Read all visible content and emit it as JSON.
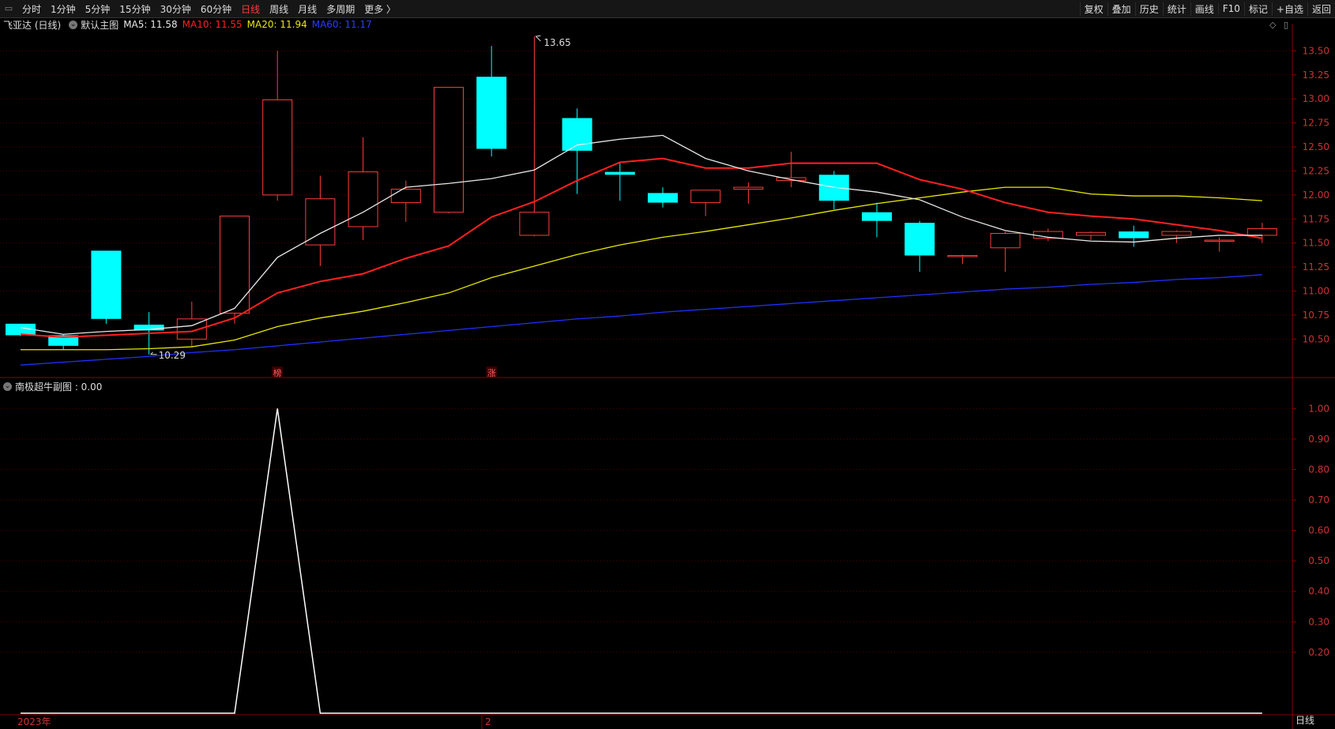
{
  "toolbar": {
    "periods": [
      "分时",
      "1分钟",
      "5分钟",
      "15分钟",
      "30分钟",
      "60分钟",
      "日线",
      "周线",
      "月线",
      "多周期",
      "更多 〉"
    ],
    "active_period": "日线",
    "tools": [
      "复权",
      "叠加",
      "历史",
      "统计",
      "画线",
      "F10",
      "标记",
      "+自选",
      "返回"
    ]
  },
  "main_header": {
    "stock": "飞亚达 (日线)",
    "indicator": "默认主图",
    "ma5_label": "MA5: 11.58",
    "ma10_label": "MA10: 11.55",
    "ma20_label": "MA20: 11.94",
    "ma60_label": "MA60: 11.17"
  },
  "sub_header": {
    "name": "南极超牛副图 : 0.00"
  },
  "bottom": {
    "year_label": "2023年",
    "month_label": "2",
    "period_label": "日线"
  },
  "colors": {
    "up": "#ff3b3b",
    "down": "#00ffff",
    "ma5": "#e8e8e8",
    "ma10": "#ff2020",
    "ma20": "#e8e800",
    "ma60": "#2030ff",
    "axis": "#8b0000",
    "sub_line": "#ffffff"
  },
  "chart_data": [
    {
      "type": "candlestick",
      "x": [
        1,
        2,
        3,
        4,
        5,
        6,
        7,
        8,
        9,
        10,
        11,
        12,
        13,
        14,
        15,
        16,
        17,
        18,
        19,
        20,
        21,
        22,
        23,
        24,
        25,
        26,
        27,
        28,
        29,
        30
      ],
      "open": [
        10.66,
        10.54,
        11.42,
        10.65,
        10.5,
        10.77,
        12.0,
        11.48,
        11.67,
        11.92,
        11.82,
        13.23,
        11.58,
        12.8,
        12.24,
        12.02,
        11.92,
        12.06,
        12.15,
        12.21,
        11.82,
        11.71,
        11.37,
        11.45,
        11.55,
        11.58,
        11.62,
        11.58,
        11.53,
        11.58
      ],
      "high": [
        10.66,
        10.55,
        11.42,
        10.78,
        10.89,
        11.78,
        13.5,
        12.2,
        12.6,
        12.15,
        11.88,
        13.55,
        13.65,
        12.9,
        12.34,
        12.08,
        12.05,
        12.13,
        12.45,
        12.25,
        11.92,
        11.73,
        11.38,
        11.62,
        11.65,
        11.62,
        11.68,
        11.63,
        11.56,
        11.71
      ],
      "low": [
        10.53,
        10.39,
        10.66,
        10.34,
        10.42,
        10.66,
        11.94,
        11.26,
        11.53,
        11.72,
        11.81,
        12.4,
        11.57,
        12.01,
        11.94,
        11.87,
        11.78,
        11.91,
        12.08,
        11.85,
        11.56,
        11.2,
        11.28,
        11.2,
        11.52,
        11.53,
        11.46,
        11.5,
        11.41,
        11.5
      ],
      "close": [
        10.54,
        10.43,
        10.71,
        10.59,
        10.71,
        11.78,
        12.99,
        11.96,
        12.24,
        12.06,
        13.12,
        12.48,
        11.82,
        12.46,
        12.21,
        11.92,
        12.05,
        12.08,
        12.18,
        11.94,
        11.73,
        11.37,
        11.37,
        11.6,
        11.62,
        11.61,
        11.55,
        11.62,
        11.53,
        11.65
      ],
      "ma5": [
        10.62,
        10.55,
        10.58,
        10.6,
        10.64,
        10.82,
        11.35,
        11.6,
        11.82,
        12.08,
        12.12,
        12.17,
        12.26,
        12.52,
        12.58,
        12.62,
        12.38,
        12.25,
        12.16,
        12.08,
        12.03,
        11.95,
        11.77,
        11.63,
        11.56,
        11.52,
        11.51,
        11.55,
        11.58,
        11.58
      ],
      "ma10": [
        10.55,
        10.52,
        10.54,
        10.56,
        10.58,
        10.72,
        10.98,
        11.1,
        11.18,
        11.34,
        11.47,
        11.77,
        11.93,
        12.15,
        12.34,
        12.38,
        12.28,
        12.28,
        12.33,
        12.33,
        12.33,
        12.16,
        12.06,
        11.92,
        11.82,
        11.78,
        11.75,
        11.69,
        11.63,
        11.55
      ],
      "ma20": [
        10.39,
        10.39,
        10.39,
        10.4,
        10.42,
        10.49,
        10.63,
        10.72,
        10.79,
        10.88,
        10.98,
        11.14,
        11.26,
        11.38,
        11.48,
        11.56,
        11.62,
        11.69,
        11.76,
        11.84,
        11.91,
        11.97,
        12.03,
        12.08,
        12.08,
        12.01,
        11.99,
        11.99,
        11.97,
        11.94
      ],
      "ma60": [
        10.23,
        10.26,
        10.29,
        10.32,
        10.36,
        10.39,
        10.43,
        10.47,
        10.51,
        10.55,
        10.59,
        10.63,
        10.67,
        10.71,
        10.74,
        10.78,
        10.81,
        10.84,
        10.87,
        10.9,
        10.93,
        10.96,
        10.99,
        11.02,
        11.04,
        11.07,
        11.09,
        11.12,
        11.14,
        11.17
      ],
      "max_label": "13.65",
      "min_label": "10.29",
      "markers": [
        "榜",
        "涨"
      ],
      "ylim": [
        10.1,
        13.7
      ],
      "yticks": [
        "13.50",
        "13.25",
        "13.00",
        "12.75",
        "12.50",
        "12.25",
        "12.00",
        "11.75",
        "11.50",
        "11.25",
        "11.00",
        "10.75",
        "10.50"
      ]
    },
    {
      "type": "line",
      "x": [
        1,
        2,
        3,
        4,
        5,
        6,
        7,
        8,
        9,
        10,
        11,
        12,
        13,
        14,
        15,
        16,
        17,
        18,
        19,
        20,
        21,
        22,
        23,
        24,
        25,
        26,
        27,
        28,
        29,
        30
      ],
      "values": [
        0,
        0,
        0,
        0,
        0,
        0,
        1,
        0,
        0,
        0,
        0,
        0,
        0,
        0,
        0,
        0,
        0,
        0,
        0,
        0,
        0,
        0,
        0,
        0,
        0,
        0,
        0,
        0,
        0,
        0
      ],
      "ylim": [
        0,
        1.05
      ],
      "yticks": [
        "1.00",
        "0.90",
        "0.80",
        "0.70",
        "0.60",
        "0.50",
        "0.40",
        "0.30",
        "0.20"
      ]
    }
  ]
}
